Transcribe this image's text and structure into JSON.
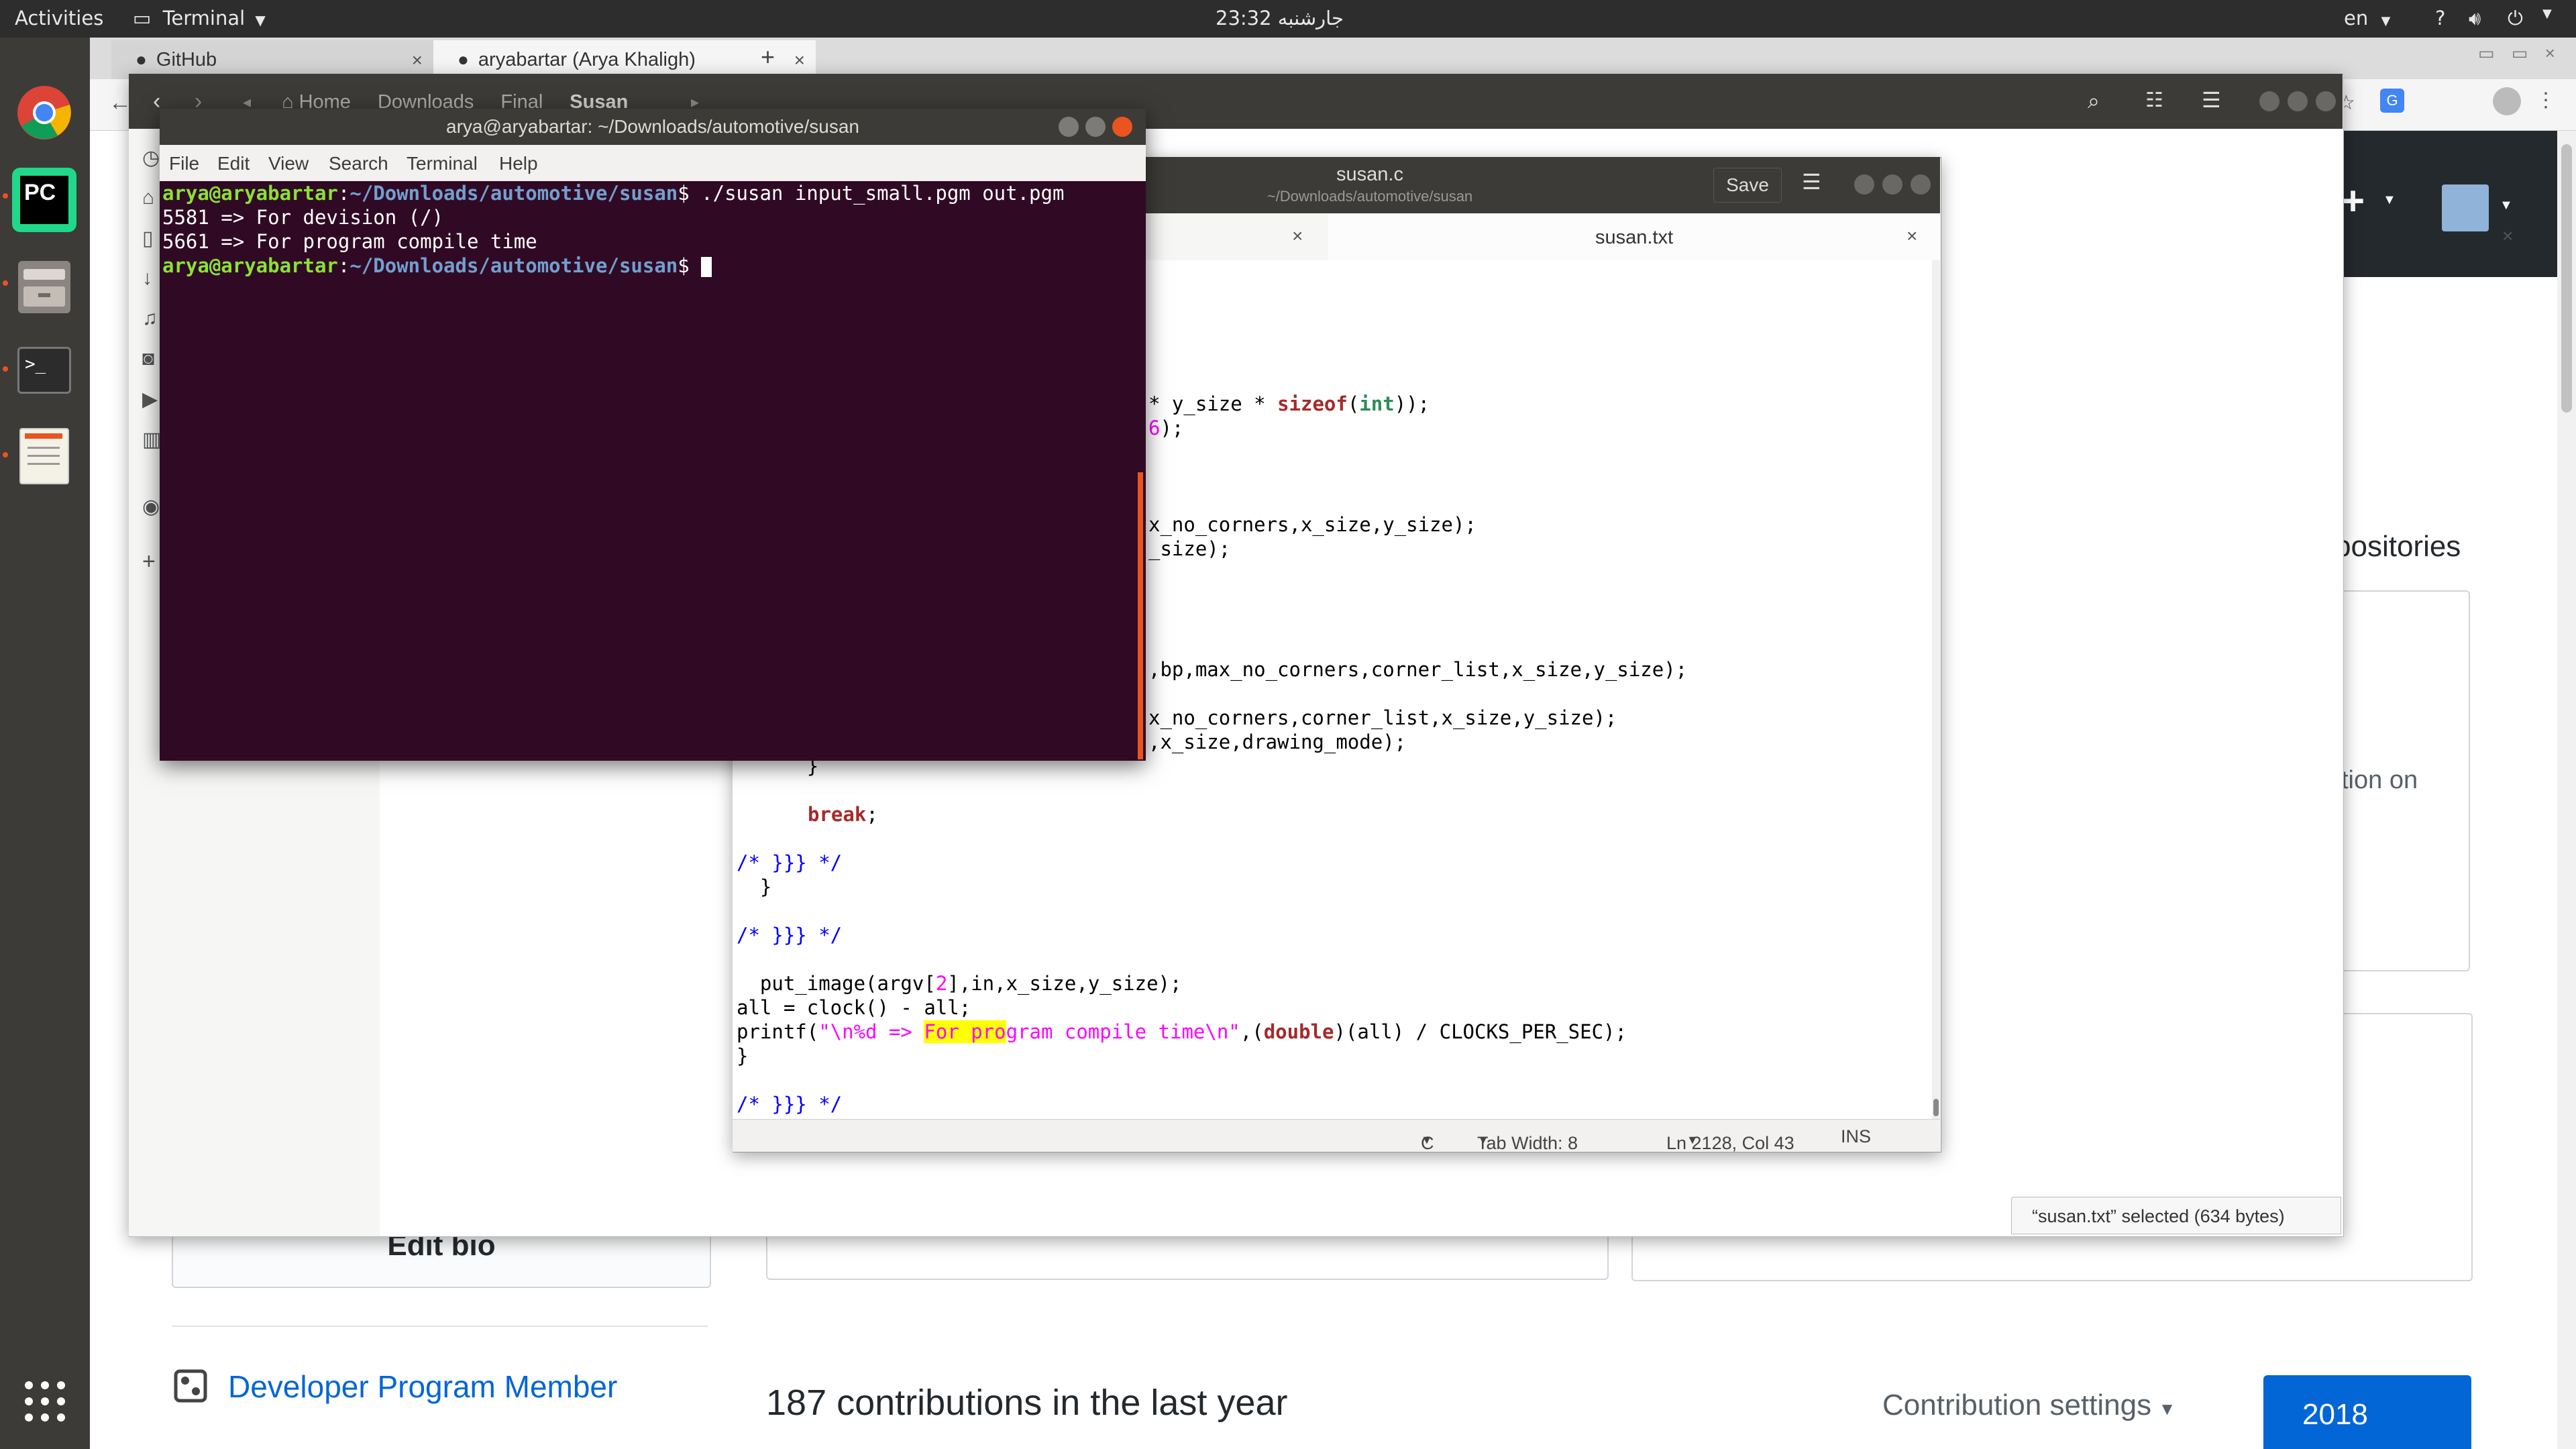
{
  "topbar": {
    "activities": "Activities",
    "app_menu": "Terminal",
    "clock": "23:32 جارشنبه",
    "lang": "en"
  },
  "dock": {
    "apps": [
      "chrome-icon",
      "pycharm-icon",
      "files-icon",
      "terminal-icon",
      "text-editor-icon"
    ]
  },
  "chrome": {
    "tabs": [
      {
        "label": "GitHub"
      },
      {
        "label": "aryabartar (Arya Khaligh)"
      }
    ],
    "new_tab": "+"
  },
  "github": {
    "repositories_fragment": "positories",
    "location_fragment": "tion on",
    "edit_bio": "Edit bio",
    "developer_program": "Developer Program Member",
    "contributions": "187 contributions in the last year",
    "contribution_settings": "Contribution settings",
    "year": "2018"
  },
  "files": {
    "breadcrumbs": [
      "Home",
      "Downloads",
      "Final",
      "Susan"
    ],
    "status": "“susan.txt” selected  (634 bytes)"
  },
  "gedit": {
    "title": "susan.c",
    "subtitle": "~/Downloads/automotive/susan",
    "save": "Save",
    "tabs": [
      {
        "label": ""
      },
      {
        "label": "susan.txt"
      }
    ],
    "status": {
      "language": "C",
      "tab_width": "Tab Width: 8",
      "position": "Ln 2128, Col 43",
      "mode": "INS"
    },
    "code": {
      "l1_pre": "* y_size * ",
      "l1_kw": "sizeof",
      "l1_mid": "(",
      "l1_ty": "int",
      "l1_post": "));",
      "l2_num": "6",
      "l2_post": ");",
      "l3": "x_no_corners,x_size,y_size);",
      "l4": "_size);",
      "l5": ",bp,max_no_corners,corner_list,x_size,y_size);",
      "l6": "x_no_corners,corner_list,x_size,y_size);",
      "l7": ",x_size,drawing_mode);",
      "l8": "      }",
      "l9_kw": "break",
      "l9_post": ";",
      "l10": "/* }}} */",
      "l11": "  }",
      "l12": "/* }}} */",
      "l13_pre": "  put_image(argv[",
      "l13_num": "2",
      "l13_post": "],in,x_size,y_size);",
      "l14": "all = clock() - all;",
      "l15_pre": "printf(",
      "l15_s1": "\"\\n%d => ",
      "l15_hl": "For pro",
      "l15_s2": "gram compile time\\n\"",
      "l15_mid": ",(",
      "l15_kw": "double",
      "l15_post": ")(all) / CLOCKS_PER_SEC);",
      "l16": "}",
      "l17": "/* }}} */"
    }
  },
  "terminal": {
    "title": "arya@aryabartar: ~/Downloads/automotive/susan",
    "menu": [
      "File",
      "Edit",
      "View",
      "Search",
      "Terminal",
      "Help"
    ],
    "prompt_user": "arya@aryabartar",
    "prompt_path": "~/Downloads/automotive/susan",
    "command": "./susan input_small.pgm out.pgm",
    "output": [
      "5581 => For devision (/)",
      "5661 => For program compile time"
    ]
  }
}
